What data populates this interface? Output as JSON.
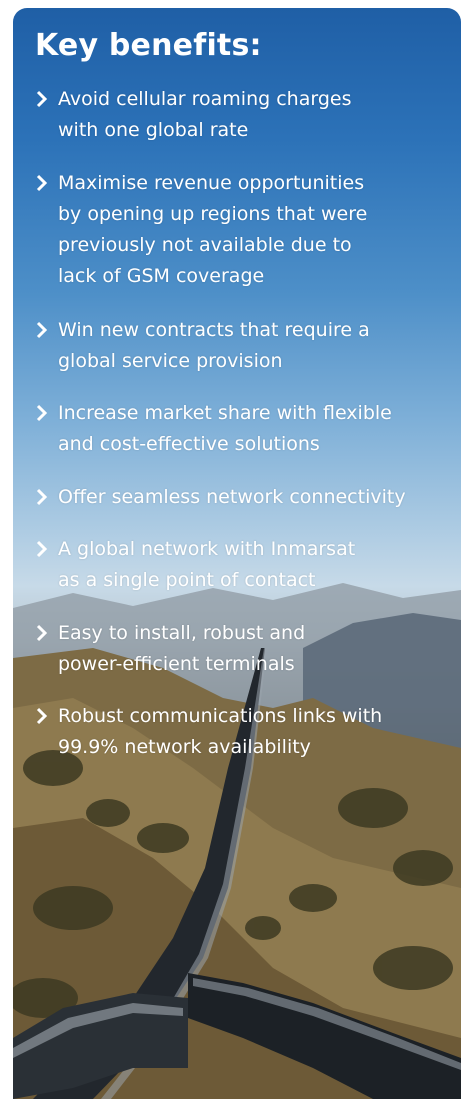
{
  "title": "Key benefits:",
  "benefits": [
    {
      "icon": "chevron-right-icon",
      "lines": [
        "Avoid cellular roaming charges",
        "with one global rate"
      ]
    },
    {
      "icon": "chevron-right-icon",
      "lines": [
        "Maximise revenue opportunities",
        "by opening up regions that were",
        "previously not available due to",
        "lack of GSM coverage"
      ]
    },
    {
      "icon": "chevron-right-icon",
      "lines": [
        "Win new contracts that require a",
        "global service provision"
      ]
    },
    {
      "icon": "chevron-right-icon",
      "lines": [
        "Increase market share with flexible",
        "and cost-effective solutions"
      ]
    },
    {
      "icon": "chevron-right-icon",
      "lines": [
        "Offer seamless network connectivity"
      ]
    },
    {
      "icon": "chevron-right-icon",
      "lines": [
        "A global network with Inmarsat",
        "as a single point of contact"
      ]
    },
    {
      "icon": "chevron-right-icon",
      "lines": [
        "Easy to install, robust and",
        "power-efficient terminals"
      ]
    },
    {
      "icon": "chevron-right-icon",
      "lines": [
        "Robust communications links with",
        "99.9% network availability"
      ]
    }
  ],
  "colors": {
    "text": "#ffffff",
    "sky_top": "#1f5fa6",
    "pipeline": "#20252b"
  }
}
